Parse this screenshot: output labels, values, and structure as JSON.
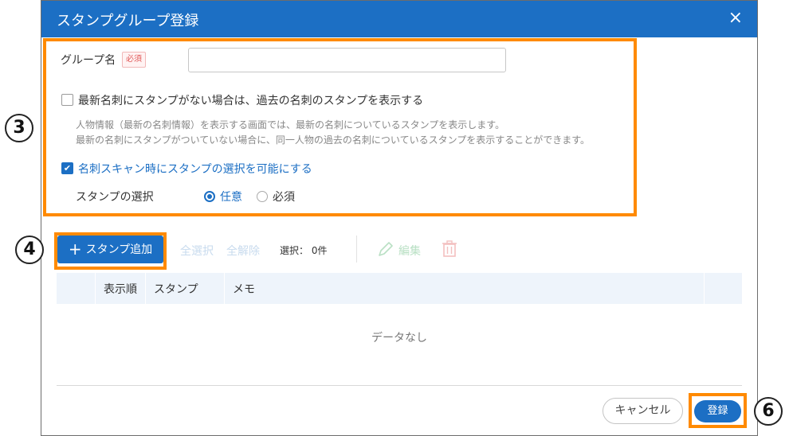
{
  "dialog": {
    "title": "スタンプグループ登録",
    "close_icon": "×"
  },
  "form": {
    "group_name_label": "グループ名",
    "required_badge": "必須",
    "group_name_value": "",
    "show_past_label": "最新名刺にスタンプがない場合は、過去の名刺のスタンプを表示する",
    "show_past_checked": false,
    "show_past_hint_1": "人物情報（最新の名刺情報）を表示する画面では、最新の名刺についているスタンプを表示します。",
    "show_past_hint_2": "最新の名刺にスタンプがついていない場合に、同一人物の過去の名刺についているスタンプを表示することができます。",
    "scan_select_label": "名刺スキャン時にスタンプの選択を可能にする",
    "scan_select_checked": true,
    "stamp_select_label": "スタンプの選択",
    "options": [
      {
        "label": "任意",
        "selected": true
      },
      {
        "label": "必須",
        "selected": false
      }
    ]
  },
  "toolbar": {
    "add_stamp_label": "スタンプ追加",
    "select_all_label": "全選択",
    "deselect_all_label": "全解除",
    "selected_count_text": "選択： 0件",
    "edit_label": "編集",
    "edit_icon": "pencil-icon",
    "delete_icon": "trash-icon"
  },
  "table": {
    "columns": [
      "表示順",
      "スタンプ",
      "メモ"
    ],
    "rows": [],
    "empty_text": "データなし"
  },
  "footer": {
    "cancel_label": "キャンセル",
    "submit_label": "登録"
  },
  "annotations": {
    "step_3": "3",
    "step_4": "4",
    "step_6": "6"
  },
  "colors": {
    "primary": "#1c6fc4",
    "highlight": "#ff8a00",
    "required_badge": "#e05858"
  }
}
